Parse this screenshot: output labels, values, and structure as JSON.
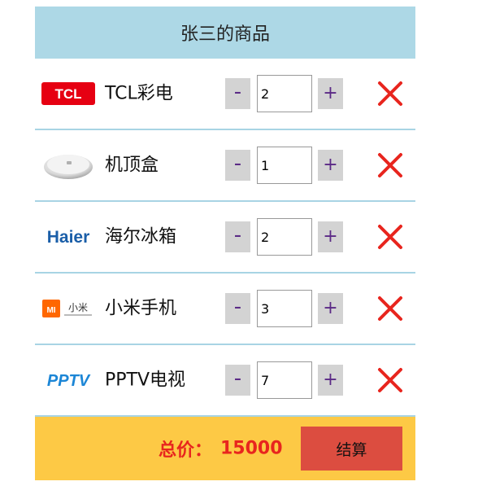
{
  "header": {
    "title": "张三的商品"
  },
  "controls": {
    "minus_label": "-",
    "plus_label": "+"
  },
  "items": [
    {
      "name": "TCL彩电",
      "qty": "2",
      "logo": "tcl-logo"
    },
    {
      "name": "机顶盒",
      "qty": "1",
      "logo": "set-top-box-image"
    },
    {
      "name": "海尔冰箱",
      "qty": "2",
      "logo": "haier-logo"
    },
    {
      "name": "小米手机",
      "qty": "3",
      "logo": "xiaomi-logo"
    },
    {
      "name": "PPTV电视",
      "qty": "7",
      "logo": "pptv-logo"
    }
  ],
  "footer": {
    "total_label": "总价：",
    "total_value": "15000",
    "checkout_label": "结算"
  },
  "tcl_text": "TCL",
  "haier_text": "Haier",
  "xiaomi_text": "小米",
  "xiaomi_mi": "MI",
  "pptv_text": "PPTV",
  "colors": {
    "header_bg": "#add8e6",
    "footer_bg": "#fdc945",
    "checkout_bg": "#dc4d40",
    "delete_red": "#e8251e",
    "tcl_red": "#e60012",
    "haier_blue": "#1a5ea8",
    "xiaomi_orange": "#ff6700",
    "pptv_blue": "#1c86d6"
  }
}
